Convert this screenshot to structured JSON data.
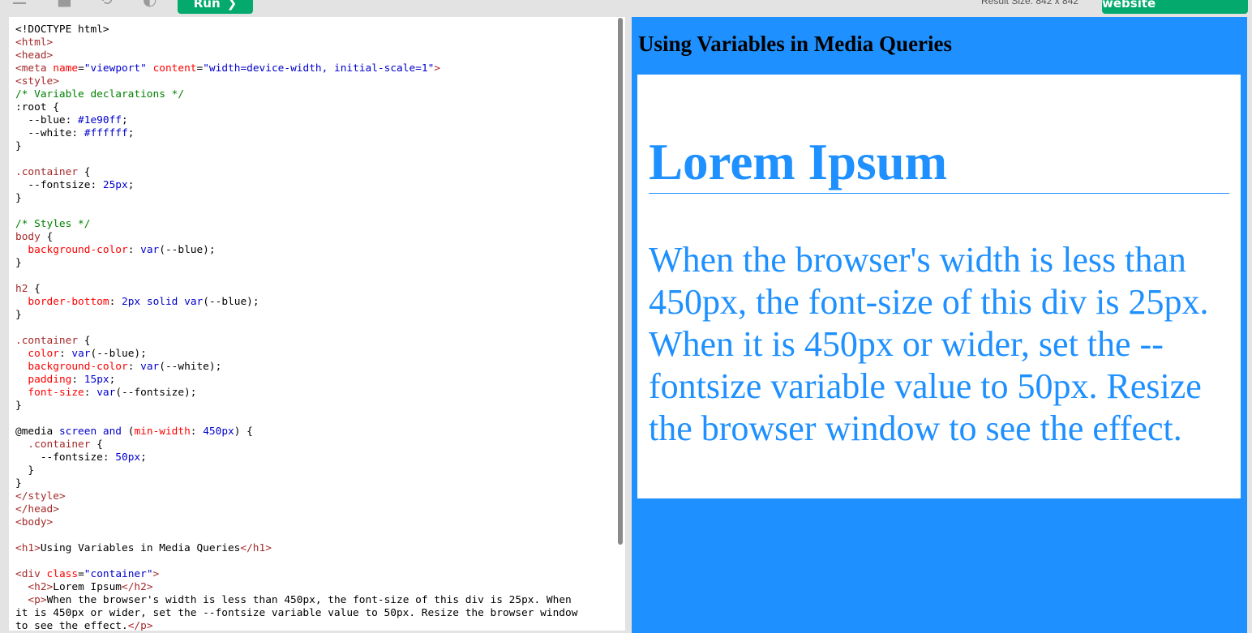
{
  "toolbar": {
    "menu_icon": "menu-icon",
    "theme_icon": "contrast-icon",
    "orientation_icon": "rotate-icon",
    "run_label": "Run",
    "run_arrow": "❯",
    "result_size": "Result Size: 842 x 842",
    "own_site_label": "Get your own website"
  },
  "editor": {
    "lines": [
      "<!DOCTYPE html>",
      "<html>",
      "<head>",
      "<meta name=\"viewport\" content=\"width=device-width, initial-scale=1\">",
      "<style>",
      "/* Variable declarations */",
      ":root {",
      "  --blue: #1e90ff;",
      "  --white: #ffffff;",
      "}",
      "",
      ".container {",
      "  --fontsize: 25px;",
      "}",
      "",
      "/* Styles */",
      "body {",
      "  background-color: var(--blue);",
      "}",
      "",
      "h2 {",
      "  border-bottom: 2px solid var(--blue);",
      "}",
      "",
      ".container {",
      "  color: var(--blue);",
      "  background-color: var(--white);",
      "  padding: 15px;",
      "  font-size: var(--fontsize);",
      "}",
      "",
      "@media screen and (min-width: 450px) {",
      "  .container {",
      "    --fontsize: 50px;",
      "  }",
      "}",
      "</style>",
      "</head>",
      "<body>",
      "",
      "<h1>Using Variables in Media Queries</h1>",
      "",
      "<div class=\"container\">",
      "  <h2>Lorem Ipsum</h2>",
      "  <p>When the browser's width is less than 450px, the font-size of this div is 25px. When",
      "it is 450px or wider, set the --fontsize variable value to 50px. Resize the browser window",
      "to see the effect.</p>"
    ]
  },
  "result": {
    "background_color": "#1e90ff",
    "h1": "Using Variables in Media Queries",
    "h2": "Lorem Ipsum",
    "paragraph": "When the browser's width is less than 450px, the font-size of this div is 25px. When it is 450px or wider, set the --fontsize variable value to 50px. Resize the browser window to see the effect."
  }
}
